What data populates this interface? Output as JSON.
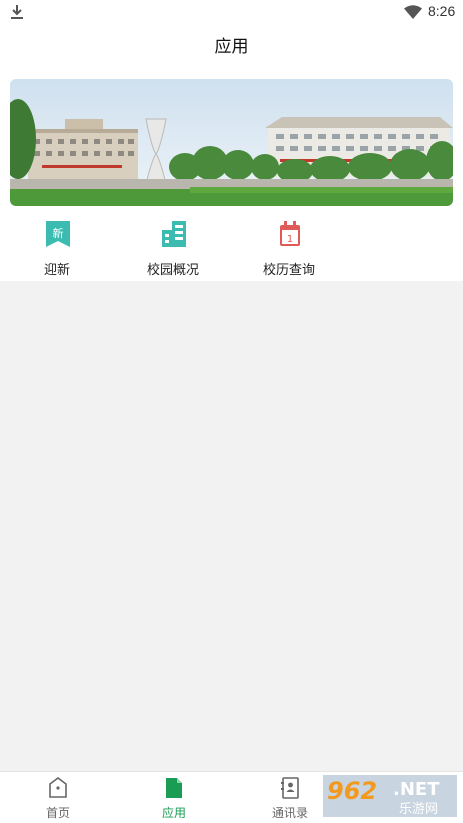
{
  "status_bar": {
    "time": "8:26",
    "icons": [
      "download-icon",
      "wifi-icon"
    ]
  },
  "header": {
    "title": "应用"
  },
  "banner": {
    "image": "campus-photo"
  },
  "apps": [
    {
      "label": "迎新",
      "icon": "new-student-icon",
      "badge_text": "新",
      "color": "#3cbcb0"
    },
    {
      "label": "校园概况",
      "icon": "building-icon",
      "color": "#3cbcb0"
    },
    {
      "label": "校历查询",
      "icon": "calendar-icon",
      "badge_text": "1",
      "color": "#e05a5a"
    }
  ],
  "tabbar": {
    "items": [
      {
        "label": "首页",
        "icon": "home-icon",
        "active": false
      },
      {
        "label": "应用",
        "icon": "file-icon",
        "active": true
      },
      {
        "label": "通讯录",
        "icon": "contacts-icon",
        "active": false
      }
    ],
    "active_color": "#1a9c55",
    "inactive_color": "#666666"
  },
  "watermark": {
    "brand": "962",
    "suffix": ".NET",
    "subtitle": "乐游网"
  }
}
